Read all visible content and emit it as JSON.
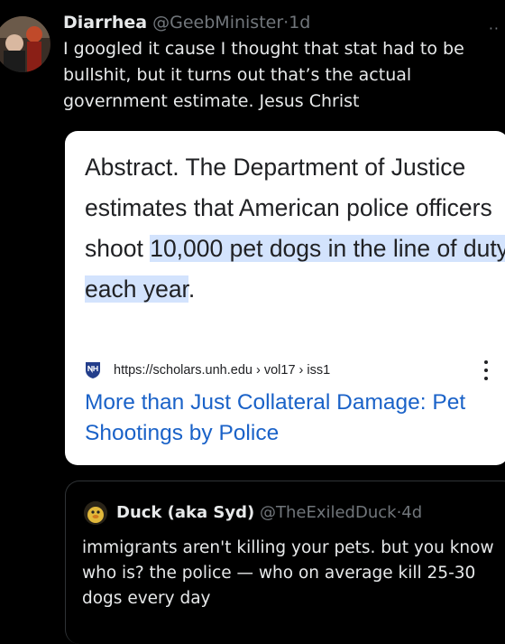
{
  "tweet": {
    "author_name": "Diarrhea",
    "handle": "@GeebMinister",
    "separator": "·",
    "time": "1d",
    "text": "I googled it cause I thought that stat had to be bullshit, but it turns out that’s the actual government estimate. Jesus Christ",
    "more_icon": "more-horizontal-icon"
  },
  "search_card": {
    "abstract_prefix": "Abstract. The Department of Justice estimates that American police officers shoot ",
    "abstract_highlight": "10,000 pet dogs in the line of duty each year",
    "abstract_suffix": ".",
    "highlight_color": "#d3e3fd",
    "source_icon": "unh-shield-icon",
    "source_url": "https://scholars.unh.edu › vol17 › iss1",
    "menu_icon": "kebab-menu-icon",
    "result_title": "More than Just Collateral Damage: Pet Shootings by Police",
    "link_color": "#1a62c8"
  },
  "quote_tweet": {
    "author_name": "Duck (aka Syd)",
    "handle": "@TheExiledDuck",
    "separator": "·",
    "time": "4d",
    "text": "immigrants aren't killing your pets. but you know who is? the police — who on average kill 25-30 dogs every day"
  },
  "colors": {
    "background": "#000000",
    "text_primary": "#e7e9ea",
    "text_secondary": "#71767b",
    "card_background": "#ffffff"
  }
}
